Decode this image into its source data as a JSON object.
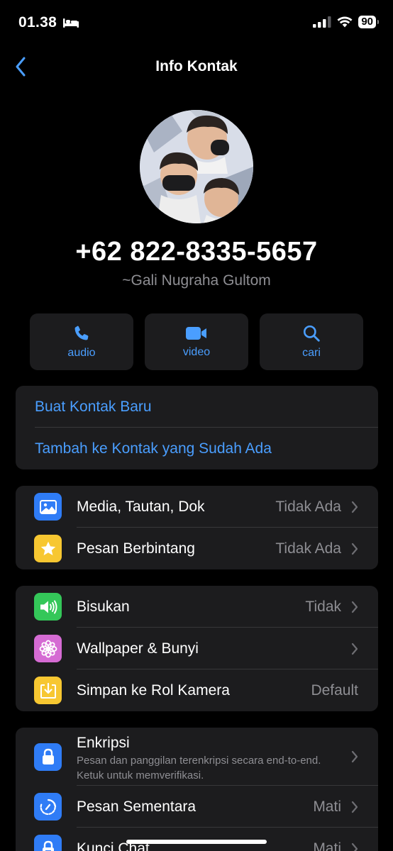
{
  "status_bar": {
    "time": "01.38",
    "battery": "90"
  },
  "header": {
    "title": "Info Kontak"
  },
  "contact": {
    "phone": "+62 822-8335-5657",
    "push_name": "~Gali Nugraha Gultom"
  },
  "actions": {
    "audio": "audio",
    "video": "video",
    "search": "cari"
  },
  "contact_options": {
    "new_contact": "Buat Kontak Baru",
    "add_existing": "Tambah ke Kontak yang Sudah Ada"
  },
  "media_group": {
    "media": {
      "label": "Media, Tautan, Dok",
      "value": "Tidak Ada"
    },
    "starred": {
      "label": "Pesan Berbintang",
      "value": "Tidak Ada"
    }
  },
  "settings_group": {
    "mute": {
      "label": "Bisukan",
      "value": "Tidak"
    },
    "wallpaper": {
      "label": "Wallpaper & Bunyi"
    },
    "save_camera_roll": {
      "label": "Simpan ke Rol Kamera",
      "value": "Default"
    }
  },
  "privacy_group": {
    "encryption": {
      "label": "Enkripsi",
      "description": "Pesan dan panggilan terenkripsi secara end-to-end. Ketuk untuk memverifikasi."
    },
    "disappearing": {
      "label": "Pesan Sementara",
      "value": "Mati"
    },
    "chat_lock": {
      "label": "Kunci Chat",
      "value": "Mati"
    }
  },
  "colors": {
    "accent": "#4a9eff",
    "media_icon": "#2f7cf6",
    "starred_icon": "#f7c731",
    "mute_icon": "#34c759",
    "wallpaper_icon": "#d56bd3",
    "save_icon": "#f7c731",
    "privacy_icon": "#2f7cf6"
  },
  "icons": {
    "back": "chevron-left-icon",
    "audio": "phone-icon",
    "video": "video-camera-icon",
    "search": "search-icon",
    "media": "photo-icon",
    "starred": "star-icon",
    "mute": "speaker-icon",
    "wallpaper": "flower-icon",
    "save": "download-icon",
    "encryption": "lock-icon",
    "disappearing": "timer-icon",
    "chat_lock": "lock-chat-icon"
  }
}
